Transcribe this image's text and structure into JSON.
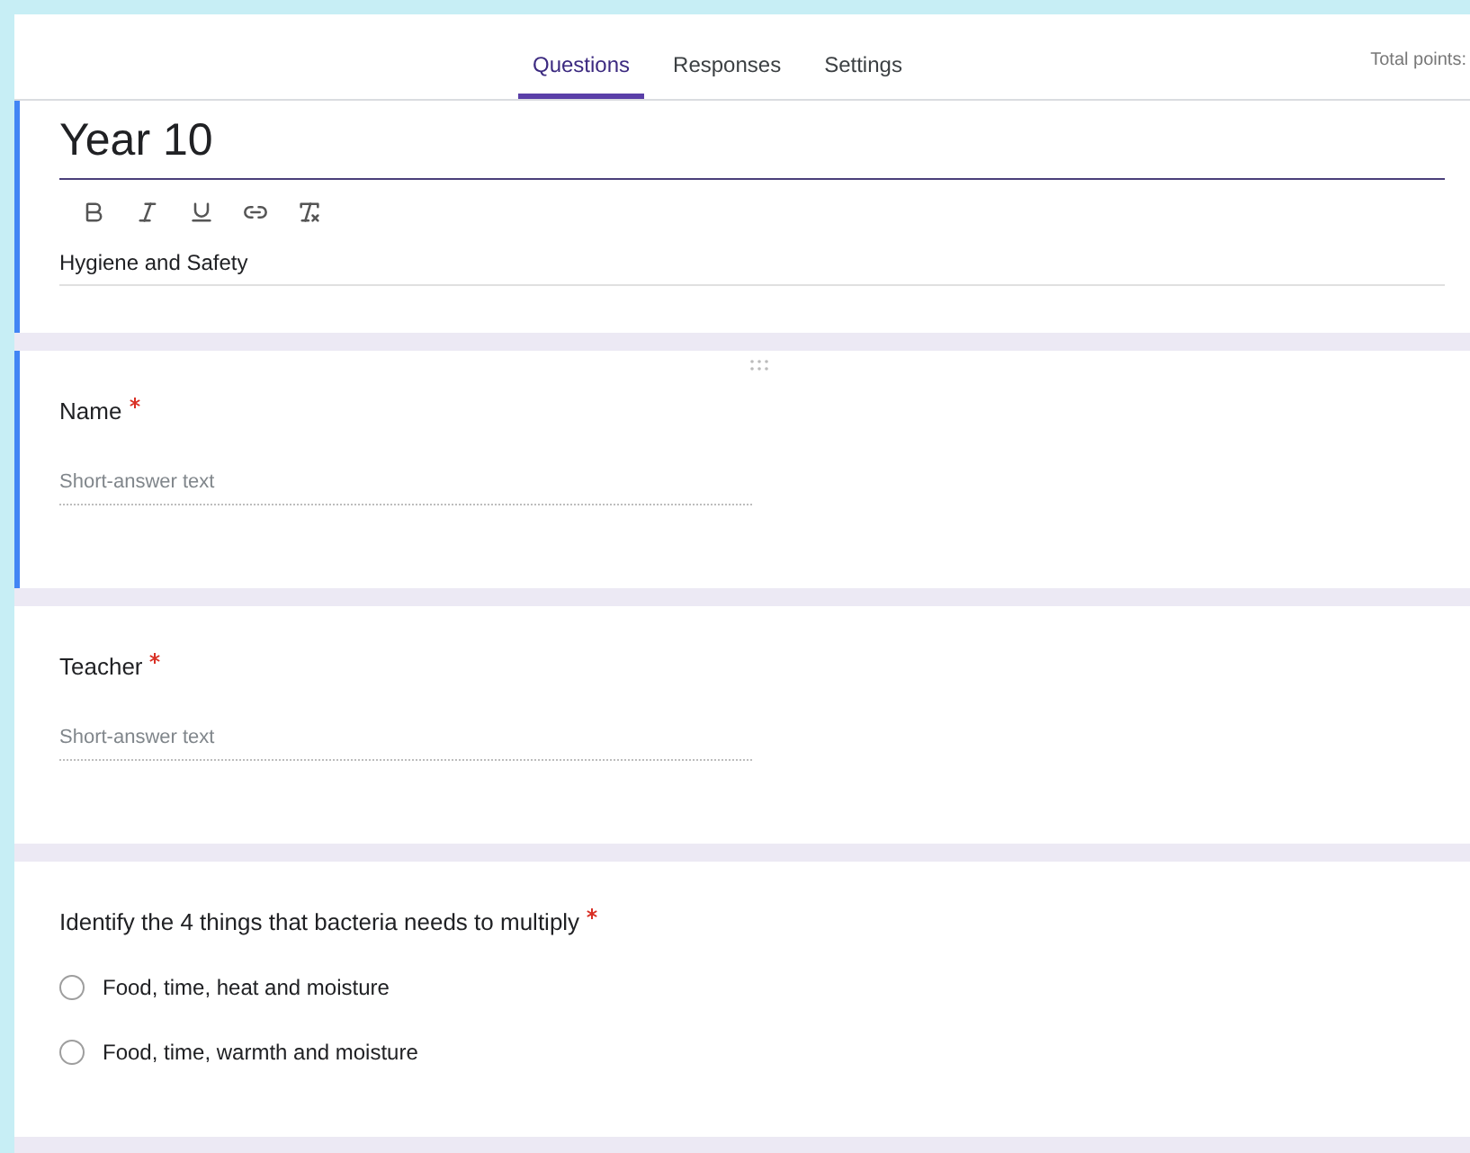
{
  "tabs": [
    {
      "label": "Questions",
      "selected": true
    },
    {
      "label": "Responses",
      "selected": false
    },
    {
      "label": "Settings",
      "selected": false
    }
  ],
  "total_points": "Total points:",
  "form": {
    "title": "Year 10",
    "description": "Hygiene and Safety"
  },
  "questions": [
    {
      "kind": "short",
      "title": "Name",
      "required": true,
      "selected": true,
      "placeholder": "Short-answer text"
    },
    {
      "kind": "short",
      "title": "Teacher",
      "required": true,
      "selected": false,
      "placeholder": "Short-answer text"
    },
    {
      "kind": "choice",
      "title": "Identify the 4 things that bacteria needs to multiply",
      "required": true,
      "selected": false,
      "options": [
        {
          "label": "Food, time, heat and moisture",
          "selected": false
        },
        {
          "label": "Food, time, warmth and moisture",
          "selected": false
        }
      ]
    }
  ]
}
